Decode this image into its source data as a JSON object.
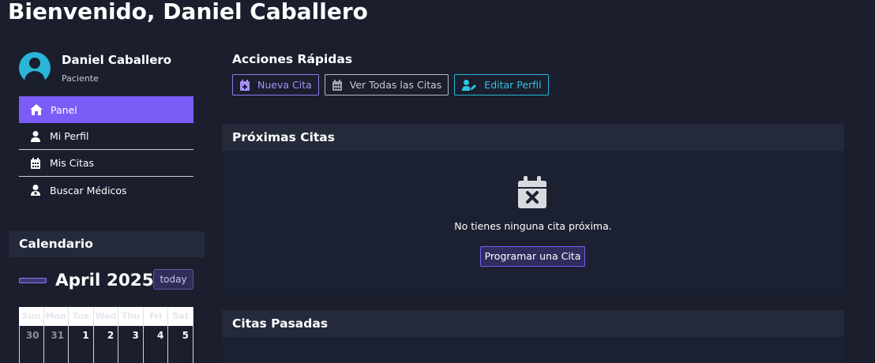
{
  "page": {
    "title": "Bienvenido, Daniel Caballero"
  },
  "profile": {
    "name": "Daniel Caballero",
    "role": "Paciente",
    "avatar_icon": "user-circle-icon"
  },
  "menu": {
    "items": [
      {
        "label": "Panel",
        "icon": "home-icon",
        "active": true
      },
      {
        "label": "Mi Perfil",
        "icon": "user-icon",
        "active": false
      },
      {
        "label": "Mis Citas",
        "icon": "calendar-icon",
        "active": false
      },
      {
        "label": "Buscar Médicos",
        "icon": "doctor-icon",
        "active": false
      }
    ]
  },
  "calendar": {
    "title": "Calendario",
    "month": "April 2025",
    "today_label": "today",
    "weekdays": [
      "Sun",
      "Mon",
      "Tue",
      "Wed",
      "Thu",
      "Fri",
      "Sat"
    ],
    "first_week": [
      "30",
      "31",
      "1",
      "2",
      "3",
      "4",
      "5"
    ]
  },
  "quick_actions": {
    "title": "Acciones Rápidas",
    "buttons": [
      {
        "label": "Nueva Cita",
        "icon": "calendar-plus-icon"
      },
      {
        "label": "Ver Todas las Citas",
        "icon": "calendar-icon"
      },
      {
        "label": "Editar Perfil",
        "icon": "user-edit-icon"
      }
    ]
  },
  "upcoming": {
    "title": "Próximas Citas",
    "empty_icon": "calendar-x-icon",
    "empty_text": "No tienes ninguna cita próxima.",
    "schedule_label": "Programar una Cita"
  },
  "past": {
    "title": "Citas Pasadas"
  },
  "colors": {
    "background": "#1a1e2d",
    "panel": "#242a3a",
    "accent": "#7c5cf7",
    "secondary": "#29b6d6"
  }
}
